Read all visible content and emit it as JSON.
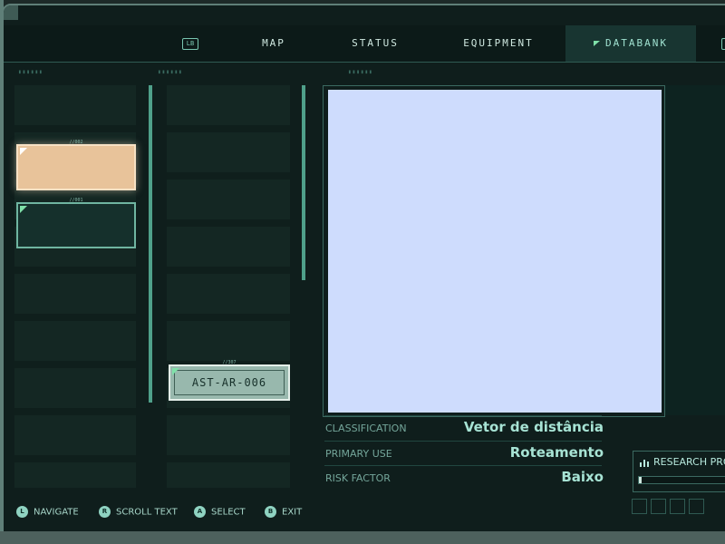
{
  "nav": {
    "left_hint": "LB",
    "right_hint": "R",
    "tabs": [
      {
        "label": "MAP"
      },
      {
        "label": "STATUS"
      },
      {
        "label": "EQUIPMENT"
      },
      {
        "label": "DATABANK",
        "active": true
      }
    ]
  },
  "entries": {
    "column1": [
      {
        "number": "//002",
        "state": "selected"
      },
      {
        "number": "//001",
        "state": "normal"
      }
    ],
    "column2": [
      {
        "number": "//307",
        "label": "AST-AR-006"
      }
    ]
  },
  "details": {
    "rows": [
      {
        "key": "CLASSIFICATION",
        "value": "Vetor de distância"
      },
      {
        "key": "PRIMARY USE",
        "value": "Roteamento"
      },
      {
        "key": "RISK FACTOR",
        "value": "Baixo"
      }
    ]
  },
  "research": {
    "label": "RESEARCH PROG",
    "progress": 0.03
  },
  "controls": [
    {
      "button": "L",
      "label": "NAVIGATE"
    },
    {
      "button": "R",
      "label": "SCROLL TEXT"
    },
    {
      "button": "A",
      "label": "SELECT"
    },
    {
      "button": "B",
      "label": "EXIT"
    }
  ],
  "colors": {
    "accent": "#7fe0a9",
    "selected_card": "#e8c39a",
    "image_placeholder": "#cedcfd",
    "background": "#0f1e1c"
  }
}
